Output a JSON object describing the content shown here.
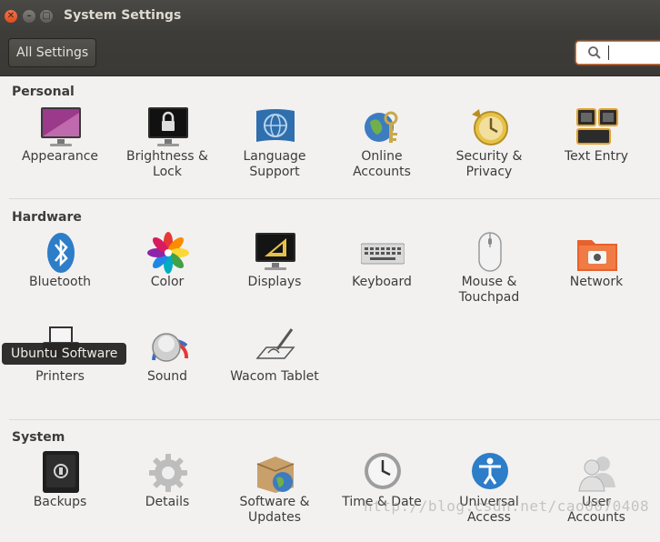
{
  "window": {
    "title": "System Settings"
  },
  "toolbar": {
    "all_settings_label": "All Settings",
    "search_value": ""
  },
  "sections": {
    "personal": {
      "title": "Personal",
      "items": [
        "Appearance",
        "Brightness &\nLock",
        "Language\nSupport",
        "Online\nAccounts",
        "Security &\nPrivacy",
        "Text Entry"
      ]
    },
    "hardware": {
      "title": "Hardware",
      "items": [
        "Bluetooth",
        "Color",
        "Displays",
        "Keyboard",
        "Mouse &\nTouchpad",
        "Network",
        "Printers",
        "Sound",
        "Wacom Tablet"
      ]
    },
    "system": {
      "title": "System",
      "items": [
        "Backups",
        "Details",
        "Software &\nUpdates",
        "Time & Date",
        "Universal\nAccess",
        "User\nAccounts"
      ]
    }
  },
  "tooltip": "Ubuntu Software",
  "watermark": "http://blog.csdn.net/cao0070408"
}
